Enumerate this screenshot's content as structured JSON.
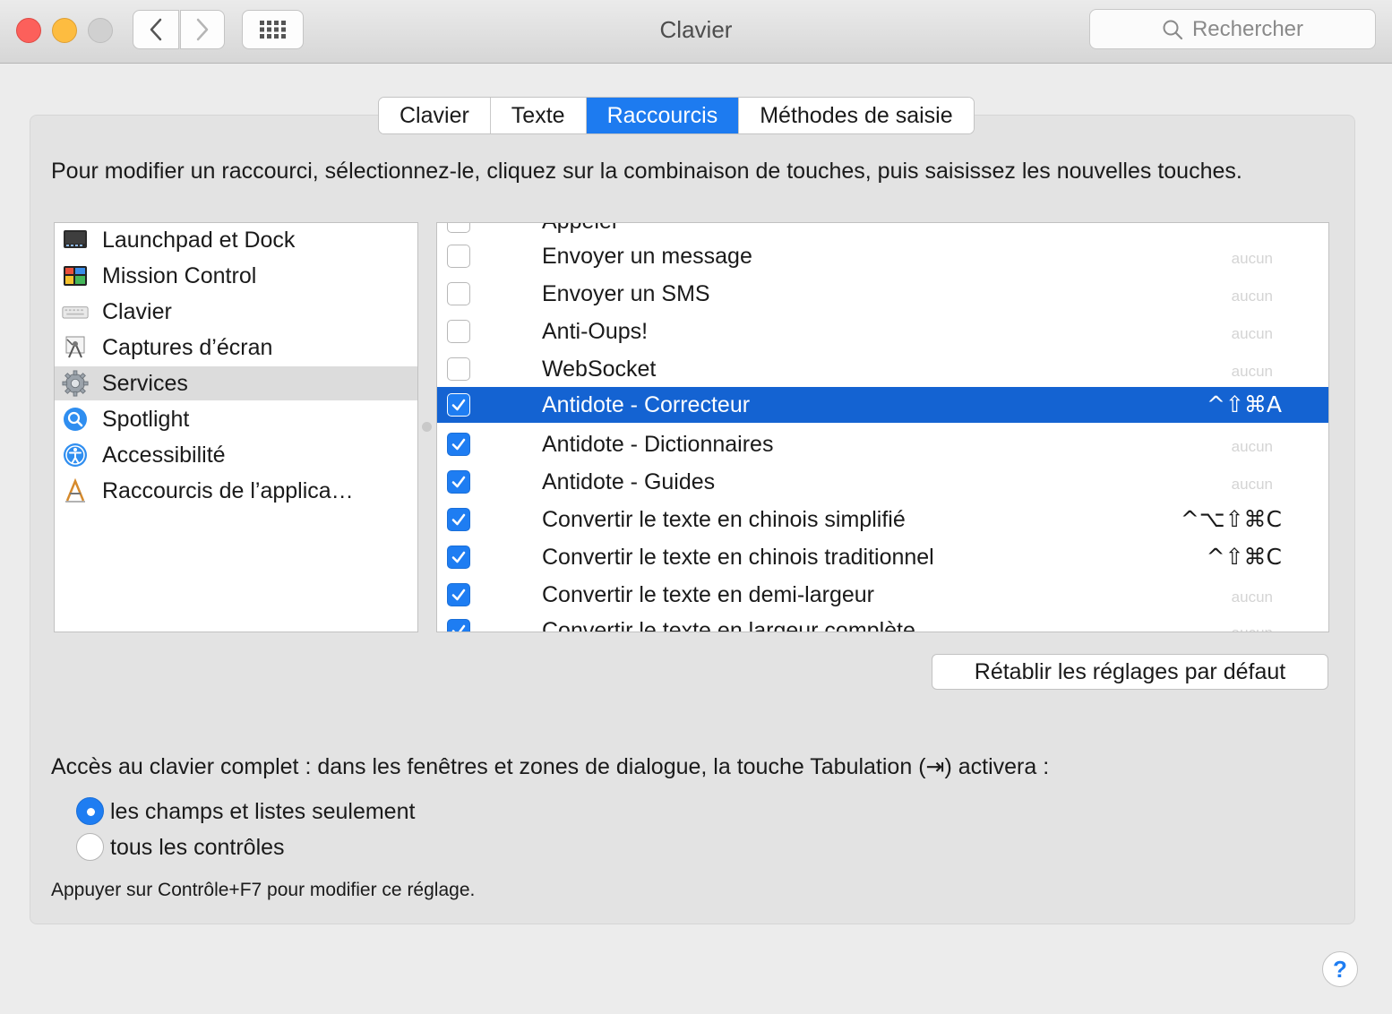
{
  "window": {
    "title": "Clavier",
    "search_placeholder": "Rechercher"
  },
  "tabs": [
    {
      "label": "Clavier",
      "active": false
    },
    {
      "label": "Texte",
      "active": false
    },
    {
      "label": "Raccourcis",
      "active": true
    },
    {
      "label": "Méthodes de saisie",
      "active": false
    }
  ],
  "instructions": "Pour modifier un raccourci, sélectionnez-le, cliquez sur la combinaison de touches, puis saisissez les nouvelles touches.",
  "categories": [
    {
      "label": "Launchpad et Dock",
      "icon": "launchpad-icon",
      "selected": false
    },
    {
      "label": "Mission Control",
      "icon": "mission-control-icon",
      "selected": false
    },
    {
      "label": "Clavier",
      "icon": "keyboard-icon",
      "selected": false
    },
    {
      "label": "Captures d’écran",
      "icon": "screenshot-icon",
      "selected": false
    },
    {
      "label": "Services",
      "icon": "gear-icon",
      "selected": true
    },
    {
      "label": "Spotlight",
      "icon": "spotlight-icon",
      "selected": false
    },
    {
      "label": "Accessibilité",
      "icon": "accessibility-icon",
      "selected": false
    },
    {
      "label": "Raccourcis de l’applica…",
      "icon": "app-shortcuts-icon",
      "selected": false
    }
  ],
  "shortcuts": [
    {
      "label": "Appeler",
      "checked": false,
      "shortcut": "",
      "selected": false
    },
    {
      "label": "Envoyer un message",
      "checked": false,
      "shortcut": "aucun",
      "selected": false
    },
    {
      "label": "Envoyer un SMS",
      "checked": false,
      "shortcut": "aucun",
      "selected": false
    },
    {
      "label": "Anti-Oups!",
      "checked": false,
      "shortcut": "aucun",
      "selected": false
    },
    {
      "label": "WebSocket",
      "checked": false,
      "shortcut": "aucun",
      "selected": false
    },
    {
      "label": "Antidote - Correcteur",
      "checked": true,
      "shortcut": "^⇧⌘A",
      "selected": true
    },
    {
      "label": "Antidote - Dictionnaires",
      "checked": true,
      "shortcut": "aucun",
      "selected": false
    },
    {
      "label": "Antidote - Guides",
      "checked": true,
      "shortcut": "aucun",
      "selected": false
    },
    {
      "label": "Convertir le texte en chinois simplifié",
      "checked": true,
      "shortcut": "^⌥⇧⌘C",
      "selected": false
    },
    {
      "label": "Convertir le texte en chinois traditionnel",
      "checked": true,
      "shortcut": "^⇧⌘C",
      "selected": false
    },
    {
      "label": "Convertir le texte en demi-largeur",
      "checked": true,
      "shortcut": "aucun",
      "selected": false
    },
    {
      "label": "Convertir le texte en largeur complète",
      "checked": true,
      "shortcut": "aucun",
      "selected": false
    }
  ],
  "reset_button": "Rétablir les réglages par défaut",
  "keyboard_access": {
    "label": "Accès au clavier complet : dans les fenêtres et zones de dialogue, la touche Tabulation (⇥) activera :",
    "options": [
      {
        "label": "les champs et listes seulement",
        "selected": true
      },
      {
        "label": "tous les contrôles",
        "selected": false
      }
    ],
    "hint": "Appuyer sur Contrôle+F7 pour modifier ce réglage."
  },
  "help_label": "?"
}
